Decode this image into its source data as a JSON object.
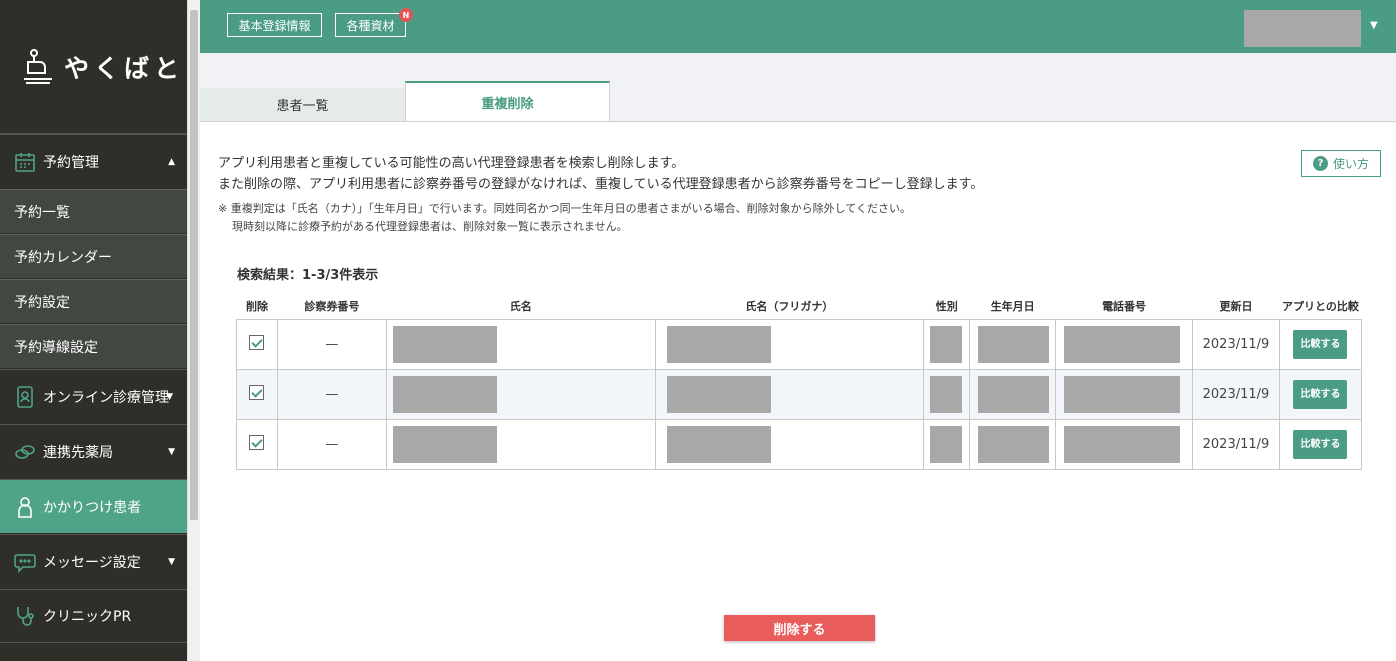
{
  "app": {
    "logo_text": "やくばと"
  },
  "header": {
    "basic_info_label": "基本登録情報",
    "materials_label": "各種資材",
    "materials_badge": "N"
  },
  "sidebar": {
    "items": [
      {
        "label": "予約管理",
        "icon": "calendar-icon",
        "expanded": true
      },
      {
        "label": "予約一覧"
      },
      {
        "label": "予約カレンダー"
      },
      {
        "label": "予約設定"
      },
      {
        "label": "予約導線設定"
      },
      {
        "label": "オンライン診療管理",
        "icon": "tablet-icon"
      },
      {
        "label": "連携先薬局",
        "icon": "pills-icon"
      },
      {
        "label": "かかりつけ患者",
        "icon": "person-icon",
        "active": true
      },
      {
        "label": "メッセージ設定",
        "icon": "chat-icon"
      },
      {
        "label": "クリニックPR",
        "icon": "stethoscope-icon"
      }
    ]
  },
  "tabs": [
    {
      "label": "患者一覧",
      "active": false
    },
    {
      "label": "重複削除",
      "active": true
    }
  ],
  "main": {
    "description_line1": "アプリ利用患者と重複している可能性の高い代理登録患者を検索し削除します。",
    "description_line2": "また削除の際、アプリ利用患者に診察券番号の登録がなければ、重複している代理登録患者から診察券番号をコピーし登録します。",
    "note_line1": "※ 重複判定は「氏名（カナ）」「生年月日」で行います。同姓同名かつ同一生年月日の患者さまがいる場合、削除対象から除外してください。",
    "note_line2": "現時刻以降に診療予約がある代理登録患者は、削除対象一覧に表示されません。",
    "help_label": "使い方",
    "result_count": "検索結果：1-3/3件表示",
    "delete_label": "削除する"
  },
  "table": {
    "headers": [
      "削除",
      "診察券番号",
      "氏名",
      "氏名（フリガナ）",
      "性別",
      "生年月日",
      "電話番号",
      "更新日",
      "アプリとの比較"
    ],
    "rows": [
      {
        "checked": true,
        "card_number": "—",
        "updated": "2023/11/9",
        "compare_label": "比較する"
      },
      {
        "checked": true,
        "card_number": "—",
        "updated": "2023/11/9",
        "compare_label": "比較する"
      },
      {
        "checked": true,
        "card_number": "—",
        "updated": "2023/11/9",
        "compare_label": "比較する"
      }
    ]
  },
  "colors": {
    "accent": "#4a9c84",
    "sidebar_bg": "#2f2f2a",
    "delete": "#e85c5c"
  }
}
